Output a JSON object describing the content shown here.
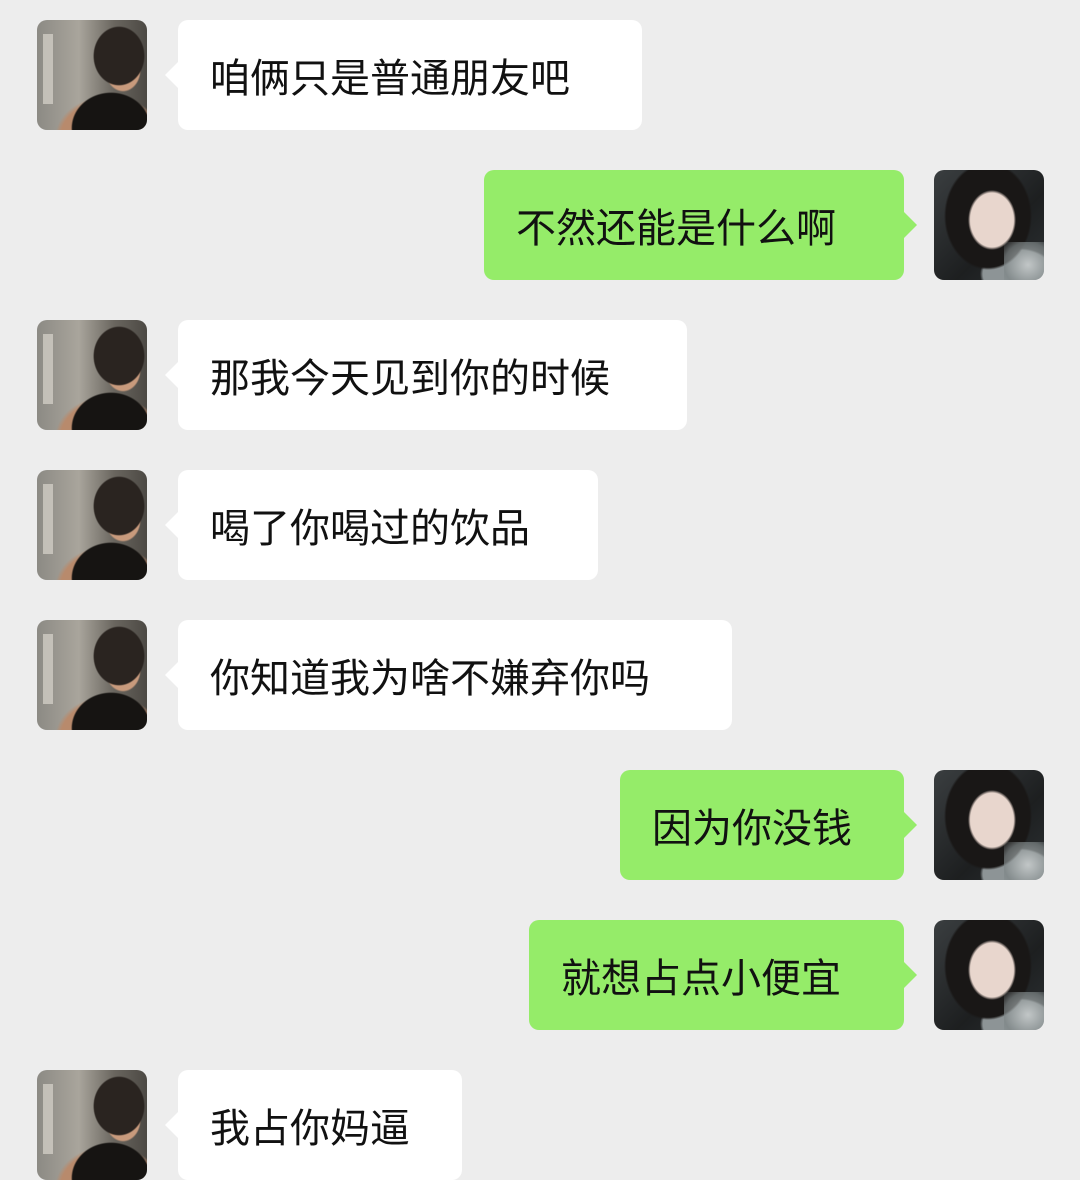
{
  "messages": [
    {
      "side": "left",
      "text": "咱俩只是普通朋友吧"
    },
    {
      "side": "right",
      "text": "不然还能是什么啊"
    },
    {
      "side": "left",
      "text": "那我今天见到你的时候"
    },
    {
      "side": "left",
      "text": "喝了你喝过的饮品"
    },
    {
      "side": "left",
      "text": "你知道我为啥不嫌弃你吗"
    },
    {
      "side": "right",
      "text": "因为你没钱"
    },
    {
      "side": "right",
      "text": "就想占点小便宜"
    },
    {
      "side": "left",
      "text": "我占你妈逼"
    }
  ],
  "colors": {
    "background": "#ededed",
    "incoming_bubble": "#ffffff",
    "outgoing_bubble": "#95ec69"
  },
  "icons": {
    "incoming_avatar": "male-avatar-photo",
    "outgoing_avatar": "female-avatar-photo"
  }
}
